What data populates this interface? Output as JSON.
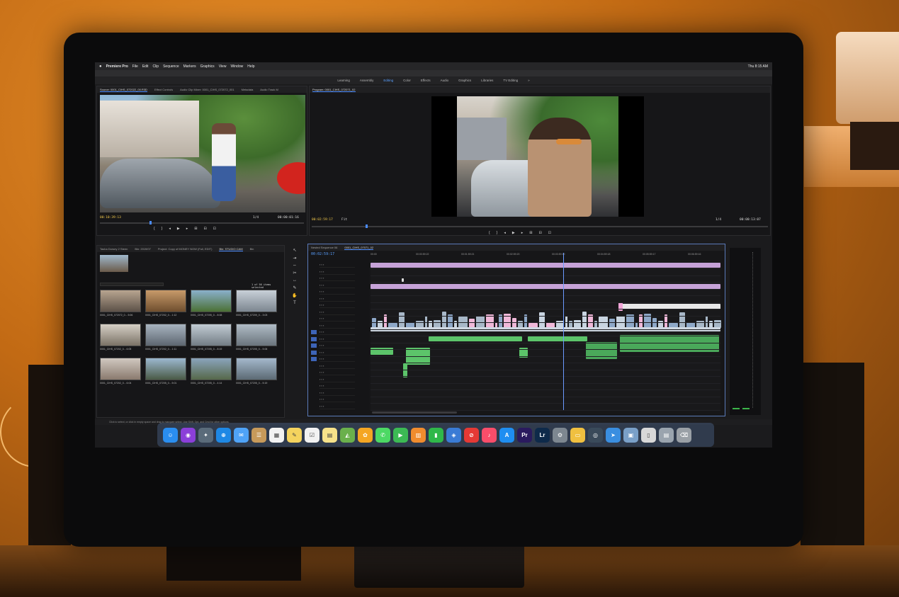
{
  "menubar": {
    "app": "Premiere Pro",
    "items": [
      "File",
      "Edit",
      "Clip",
      "Sequence",
      "Markers",
      "Graphics",
      "View",
      "Window",
      "Help"
    ],
    "clock": "Thu 8:15 AM"
  },
  "workspaces": {
    "tabs": [
      "Learning",
      "Assembly",
      "Editing",
      "Color",
      "Effects",
      "Audio",
      "Graphics",
      "Libraries",
      "TV Editing"
    ],
    "active": "Editing"
  },
  "source_monitor": {
    "tabs": [
      "Source: 0001_CIHS_072022_00.R3D",
      "Effect Controls",
      "Audio Clip Mixer: 0001_CIHS_072072_001",
      "Metadata",
      "Audio Track M"
    ],
    "timecode_in": "00:10:39:13",
    "fit": "1/4",
    "timecode_dur": "00:00:01:16"
  },
  "program_monitor": {
    "tab": "Program: 0001_CIHS_072071_02",
    "timecode_in": "00:02:59:17",
    "fit": "Fit",
    "zoom": "1/4",
    "timecode_dur": "00:00:13:07"
  },
  "project_panel": {
    "tabs": [
      "Tasha Dorsey 2 Steen",
      "Bin: 2019/07",
      "Project: Copy of MONEY NOW (Full, EDIT)",
      "Bin: STUDIO CAM",
      "Bin"
    ],
    "item_count": "1 of 56 items selected",
    "thumbs": [
      {
        "label": "0001_CIHS_072072_0...",
        "dur": "5:06",
        "c1": "#b8a590",
        "c2": "#5c5148"
      },
      {
        "label": "0001_CIHS_07202_0...",
        "dur": "1:12",
        "c1": "#c79a6a",
        "c2": "#6f4e2e"
      },
      {
        "label": "0001_CIHS_07205_0...",
        "dur": "8:08",
        "c1": "#8ab0cc",
        "c2": "#4b7034"
      },
      {
        "label": "0001_CIHS_07209_0...",
        "dur": "3:03",
        "c1": "#c8d0d8",
        "c2": "#7c8690"
      },
      {
        "label": "0001_CIHS_07202_0...",
        "dur": "6:05",
        "c1": "#d6d0c6",
        "c2": "#7a7266"
      },
      {
        "label": "0001_CIHS_07202_0...",
        "dur": "1:11",
        "c1": "#a8b4c0",
        "c2": "#5d6670"
      },
      {
        "label": "0001_CIHS_07205_0...",
        "dur": "8:19",
        "c1": "#c2ccd4",
        "c2": "#727c84"
      },
      {
        "label": "0001_CIHS_07205_0...",
        "dur": "5:06",
        "c1": "#b0bcc6",
        "c2": "#6a747c"
      },
      {
        "label": "0001_CIHS_07202_0...",
        "dur": "6:04",
        "c1": "#d0c8c0",
        "c2": "#8a7a6e"
      },
      {
        "label": "0001_CIHS_07205_0...",
        "dur": "5:01",
        "c1": "#9cb8d0",
        "c2": "#4a5a46"
      },
      {
        "label": "0001_CIHS_07205_0...",
        "dur": "4:14",
        "c1": "#8aa4bc",
        "c2": "#56684a"
      },
      {
        "label": "0001_CIHS_07205_0...",
        "dur": "5:19",
        "c1": "#a4b8cc",
        "c2": "#5c6a74"
      }
    ]
  },
  "timeline": {
    "tabs": [
      "Nested Sequence 06",
      "0001_CIHS_07071_02"
    ],
    "timecode": "00:02:59:17",
    "ruler": [
      "00:00",
      "00:00:59:22",
      "00:01:59:21",
      "00:02:59:20",
      "00:03:59:19",
      "00:04:59:18",
      "00:05:59:17",
      "00:06:59:16"
    ]
  },
  "status_bar": "Click to select, or click in empty space and drag to marquee select. Use Shift, Opt, and Cmd for other options.",
  "dock": {
    "apps": [
      {
        "name": "finder-icon",
        "glyph": "☺",
        "color": "#2a8ef0"
      },
      {
        "name": "siri-icon",
        "glyph": "◉",
        "color": "#8b3fd9"
      },
      {
        "name": "launchpad-icon",
        "glyph": "✦",
        "color": "#5a6b7a"
      },
      {
        "name": "safari-icon",
        "glyph": "⊕",
        "color": "#1e88e5"
      },
      {
        "name": "mail-icon",
        "glyph": "✉",
        "color": "#4fa3f7"
      },
      {
        "name": "contacts-icon",
        "glyph": "☰",
        "color": "#c79a5a"
      },
      {
        "name": "calendar-icon",
        "glyph": "▦",
        "color": "#f2f2f2"
      },
      {
        "name": "notes-icon",
        "glyph": "✎",
        "color": "#f4d35e"
      },
      {
        "name": "reminders-icon",
        "glyph": "☑",
        "color": "#f2f2f2"
      },
      {
        "name": "stickies-icon",
        "glyph": "▤",
        "color": "#f7e28a"
      },
      {
        "name": "maps-icon",
        "glyph": "◭",
        "color": "#6ab04c"
      },
      {
        "name": "photos-icon",
        "glyph": "✿",
        "color": "#f5a623"
      },
      {
        "name": "messages-icon",
        "glyph": "✆",
        "color": "#4cd964"
      },
      {
        "name": "facetime-icon",
        "glyph": "▶",
        "color": "#3cba54"
      },
      {
        "name": "pages-icon",
        "glyph": "▥",
        "color": "#f08c2e"
      },
      {
        "name": "numbers-icon",
        "glyph": "▮",
        "color": "#2fb84a"
      },
      {
        "name": "keynote-icon",
        "glyph": "◈",
        "color": "#3a7bd5"
      },
      {
        "name": "news-icon",
        "glyph": "⊘",
        "color": "#e53935"
      },
      {
        "name": "music-icon",
        "glyph": "♪",
        "color": "#fa4d6a"
      },
      {
        "name": "appstore-icon",
        "glyph": "A",
        "color": "#1f8ef1"
      },
      {
        "name": "premiere-icon",
        "glyph": "Pr",
        "color": "#2a1a5e"
      },
      {
        "name": "lightroom-icon",
        "glyph": "Lr",
        "color": "#0e2a4a"
      },
      {
        "name": "systemprefs-icon",
        "glyph": "⚙",
        "color": "#7d8790"
      },
      {
        "name": "folder-icon",
        "glyph": "▭",
        "color": "#f0c040"
      },
      {
        "name": "quicktime-icon",
        "glyph": "◎",
        "color": "#3a4a5a"
      },
      {
        "name": "airdrop-icon",
        "glyph": "➤",
        "color": "#3a8ee0"
      },
      {
        "name": "preview-icon",
        "glyph": "▣",
        "color": "#7aa0c8"
      },
      {
        "name": "document-icon",
        "glyph": "▯",
        "color": "#d8d8d8"
      },
      {
        "name": "downloads-icon",
        "glyph": "▤",
        "color": "#9aa4ae"
      },
      {
        "name": "trash-icon",
        "glyph": "⌫",
        "color": "#9aa0a6"
      }
    ]
  }
}
